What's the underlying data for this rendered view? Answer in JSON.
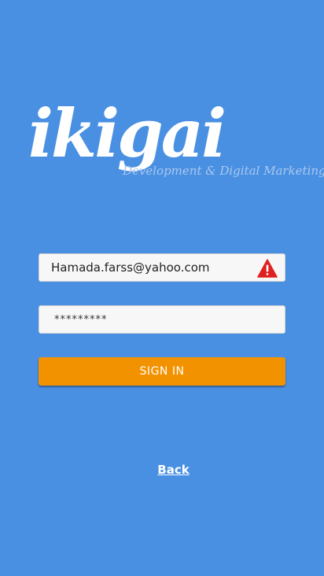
{
  "logo": {
    "word": "ikigai",
    "tagline": "Development & Digital Marketing"
  },
  "form": {
    "email": {
      "value": "Hamada.farss@yahoo.com",
      "status_icon": "warning-icon",
      "status_color": "#e02020"
    },
    "password": {
      "value": "*********"
    },
    "signin_label": "SIGN IN"
  },
  "back_label": "Back",
  "colors": {
    "background": "#4a90e2",
    "button": "#f29200",
    "field": "#f7f7f7"
  }
}
